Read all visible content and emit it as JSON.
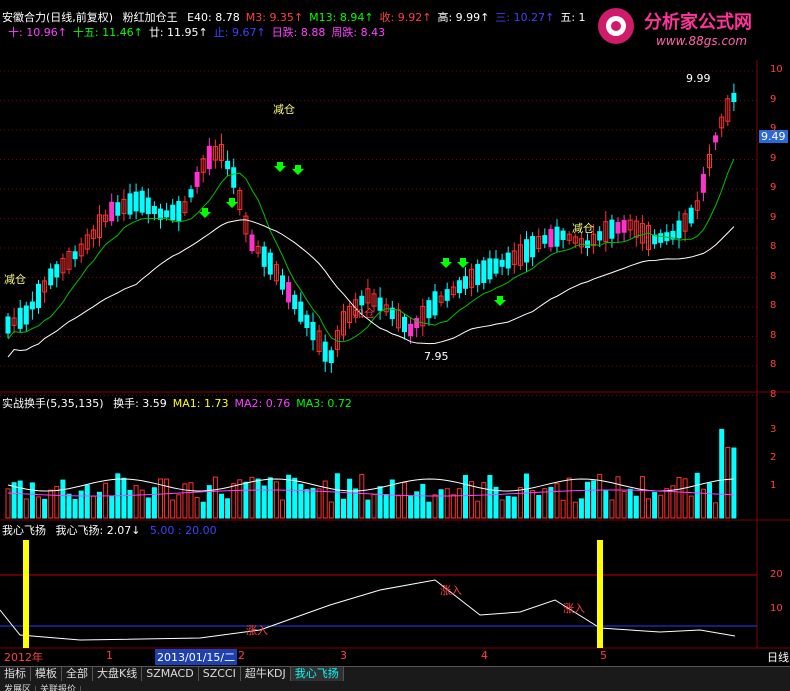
{
  "main_header": {
    "title": "安徽合力(日线,前复权)",
    "formula": "粉红加仓王",
    "items_row1": [
      {
        "text": "E40: 8.78",
        "color": "#ffffff"
      },
      {
        "text": "M3: 9.35↑",
        "color": "#ff4040"
      },
      {
        "text": "M13: 8.94↑",
        "color": "#00ff00"
      },
      {
        "text": "收: 9.92↑",
        "color": "#ff4040"
      },
      {
        "text": "高: 9.99↑",
        "color": "#ffffff"
      },
      {
        "text": "三: 10.27↑",
        "color": "#4040ff"
      },
      {
        "text": "五: 1",
        "color": "#ffffff"
      }
    ],
    "items_row2": [
      {
        "text": "十: 10.96↑",
        "color": "#ff40ff"
      },
      {
        "text": "十五: 11.46↑",
        "color": "#00ff00"
      },
      {
        "text": "廿: 11.95↑",
        "color": "#ffffff"
      },
      {
        "text": "止: 9.67↑",
        "color": "#4040ff"
      },
      {
        "text": "日跌: 8.88",
        "color": "#ff40ff"
      },
      {
        "text": "周跌: 8.43",
        "color": "#ff40ff"
      }
    ]
  },
  "logo": {
    "text": "分析家公式网",
    "url": "www.88gs.com"
  },
  "annotations": {
    "reduce1": "减仓",
    "reduce2": "减仓",
    "reduce3": "减仓",
    "add": "加仓",
    "high": "9.99",
    "low": "7.95",
    "price_tag": "9.49"
  },
  "price_axis": [
    "10",
    "9",
    "9",
    "9",
    "9",
    "9",
    "8",
    "8",
    "8",
    "8",
    "8",
    "8"
  ],
  "vol_header": {
    "title": "实战换手(5,35,135)",
    "items": [
      {
        "text": "换手: 3.59",
        "color": "#ffffff"
      },
      {
        "text": "MA1: 1.73",
        "color": "#ffff00"
      },
      {
        "text": "MA2: 0.76",
        "color": "#ff40ff"
      },
      {
        "text": "MA3: 0.72",
        "color": "#00ff00"
      }
    ]
  },
  "vol_axis": [
    "3",
    "2",
    "1"
  ],
  "ind_header": {
    "title": "我心飞扬",
    "value": "我心飞扬: 2.07↓",
    "levels": "5.00 : 20.00"
  },
  "ind_axis": [
    "20",
    "10"
  ],
  "ind_labels": {
    "l1": "涨入",
    "l2": "涨入",
    "l3": "涨入"
  },
  "time_axis": {
    "year": "2012年",
    "m1": "1",
    "date": "2013/01/15/二",
    "m2": "2",
    "m3": "3",
    "m4": "4",
    "m5": "5",
    "period": "日线"
  },
  "tabs": [
    "指标",
    "模板",
    "全部",
    "大盘K线",
    "SZMACD",
    "SZCCI",
    "超牛KDJ",
    "我心飞扬"
  ],
  "bottom_tabs": [
    "发展区",
    "关联报价"
  ],
  "colors": {
    "up": "#ff3030",
    "down": "#00ffff",
    "pink": "#ff33cc",
    "ma_white": "#ffffff",
    "ma_green": "#00c000",
    "grid": "#800000"
  }
}
